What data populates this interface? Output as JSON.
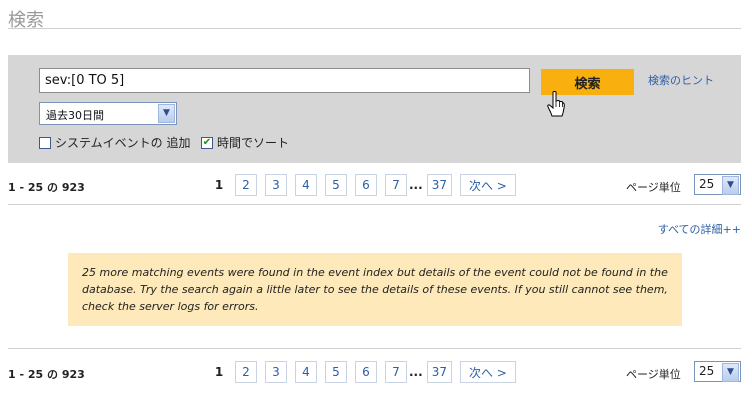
{
  "page": {
    "title": "検索"
  },
  "search": {
    "query": "sev:[0 TO 5]",
    "button_label": "検索",
    "hint_link": "検索のヒント",
    "period_selected": "過去30日間",
    "checkboxes": [
      {
        "label": "システムイベントの 追加",
        "checked": false
      },
      {
        "label": "時間でソート",
        "checked": true
      }
    ]
  },
  "pager": {
    "range_label": "1 - 25 の 923",
    "current_page": "1",
    "pages": [
      "2",
      "3",
      "4",
      "5",
      "6",
      "7"
    ],
    "ellipsis": "...",
    "last_page": "37",
    "next_label": "次へ >",
    "per_page_label": "ページ単位",
    "per_page_value": "25"
  },
  "results": {
    "all_details_link": "すべての詳細++",
    "notice": "25 more matching events were found in the event index but details of the event could not be found in the database. Try the search again a little later to see the details of these events. If you still cannot see them, check the server logs for errors."
  },
  "colors": {
    "accent_button": "#f9b00e",
    "panel": "#d6d6d6",
    "notice_bg": "#fde9b9",
    "link": "#2d5fa6"
  }
}
